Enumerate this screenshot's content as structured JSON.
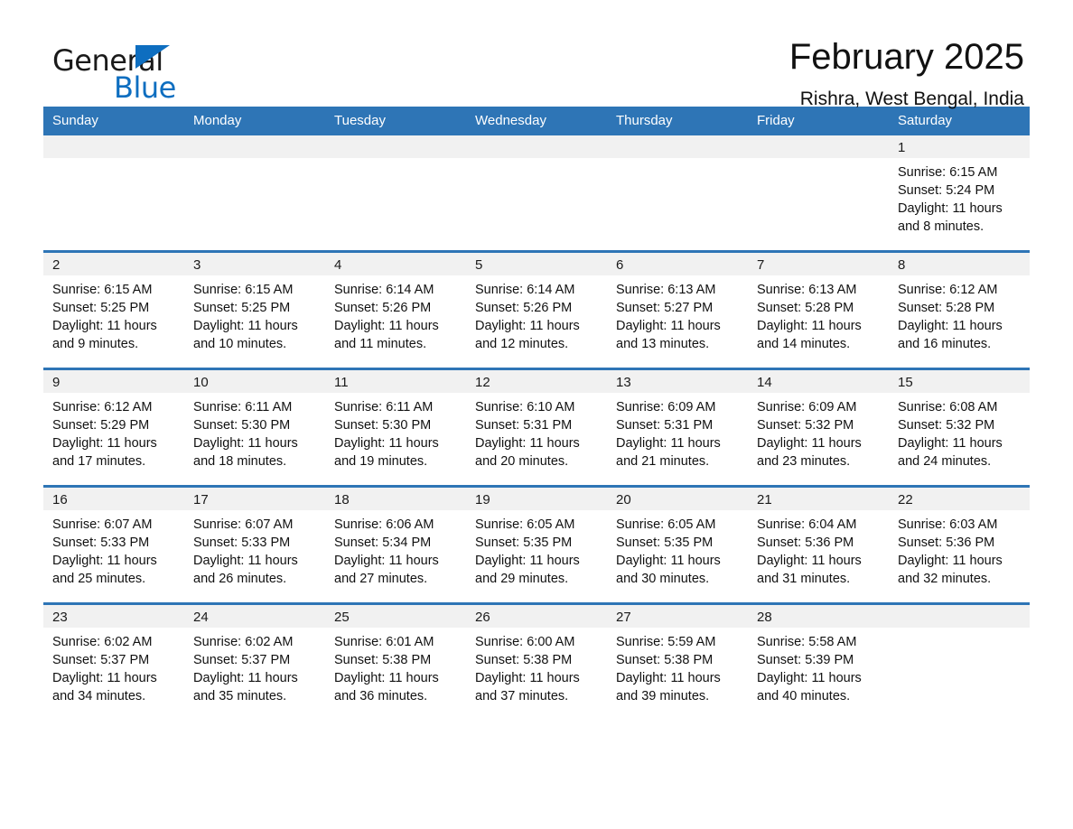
{
  "logo": {
    "word_top": "General",
    "word_bottom": "Blue",
    "triangle_icon": "triangle-icon",
    "brand_color": "#0e6ec0"
  },
  "header": {
    "month_title": "February 2025",
    "location": "Rishra, West Bengal, India"
  },
  "theme": {
    "header_blue": "#2e75b6",
    "daynum_band": "#f1f1f1",
    "text": "#111111"
  },
  "calendar": {
    "weekday_headers": [
      "Sunday",
      "Monday",
      "Tuesday",
      "Wednesday",
      "Thursday",
      "Friday",
      "Saturday"
    ],
    "weeks": [
      [
        {
          "day": ""
        },
        {
          "day": ""
        },
        {
          "day": ""
        },
        {
          "day": ""
        },
        {
          "day": ""
        },
        {
          "day": ""
        },
        {
          "day": "1",
          "sunrise": "Sunrise: 6:15 AM",
          "sunset": "Sunset: 5:24 PM",
          "daylight": "Daylight: 11 hours and 8 minutes."
        }
      ],
      [
        {
          "day": "2",
          "sunrise": "Sunrise: 6:15 AM",
          "sunset": "Sunset: 5:25 PM",
          "daylight": "Daylight: 11 hours and 9 minutes."
        },
        {
          "day": "3",
          "sunrise": "Sunrise: 6:15 AM",
          "sunset": "Sunset: 5:25 PM",
          "daylight": "Daylight: 11 hours and 10 minutes."
        },
        {
          "day": "4",
          "sunrise": "Sunrise: 6:14 AM",
          "sunset": "Sunset: 5:26 PM",
          "daylight": "Daylight: 11 hours and 11 minutes."
        },
        {
          "day": "5",
          "sunrise": "Sunrise: 6:14 AM",
          "sunset": "Sunset: 5:26 PM",
          "daylight": "Daylight: 11 hours and 12 minutes."
        },
        {
          "day": "6",
          "sunrise": "Sunrise: 6:13 AM",
          "sunset": "Sunset: 5:27 PM",
          "daylight": "Daylight: 11 hours and 13 minutes."
        },
        {
          "day": "7",
          "sunrise": "Sunrise: 6:13 AM",
          "sunset": "Sunset: 5:28 PM",
          "daylight": "Daylight: 11 hours and 14 minutes."
        },
        {
          "day": "8",
          "sunrise": "Sunrise: 6:12 AM",
          "sunset": "Sunset: 5:28 PM",
          "daylight": "Daylight: 11 hours and 16 minutes."
        }
      ],
      [
        {
          "day": "9",
          "sunrise": "Sunrise: 6:12 AM",
          "sunset": "Sunset: 5:29 PM",
          "daylight": "Daylight: 11 hours and 17 minutes."
        },
        {
          "day": "10",
          "sunrise": "Sunrise: 6:11 AM",
          "sunset": "Sunset: 5:30 PM",
          "daylight": "Daylight: 11 hours and 18 minutes."
        },
        {
          "day": "11",
          "sunrise": "Sunrise: 6:11 AM",
          "sunset": "Sunset: 5:30 PM",
          "daylight": "Daylight: 11 hours and 19 minutes."
        },
        {
          "day": "12",
          "sunrise": "Sunrise: 6:10 AM",
          "sunset": "Sunset: 5:31 PM",
          "daylight": "Daylight: 11 hours and 20 minutes."
        },
        {
          "day": "13",
          "sunrise": "Sunrise: 6:09 AM",
          "sunset": "Sunset: 5:31 PM",
          "daylight": "Daylight: 11 hours and 21 minutes."
        },
        {
          "day": "14",
          "sunrise": "Sunrise: 6:09 AM",
          "sunset": "Sunset: 5:32 PM",
          "daylight": "Daylight: 11 hours and 23 minutes."
        },
        {
          "day": "15",
          "sunrise": "Sunrise: 6:08 AM",
          "sunset": "Sunset: 5:32 PM",
          "daylight": "Daylight: 11 hours and 24 minutes."
        }
      ],
      [
        {
          "day": "16",
          "sunrise": "Sunrise: 6:07 AM",
          "sunset": "Sunset: 5:33 PM",
          "daylight": "Daylight: 11 hours and 25 minutes."
        },
        {
          "day": "17",
          "sunrise": "Sunrise: 6:07 AM",
          "sunset": "Sunset: 5:33 PM",
          "daylight": "Daylight: 11 hours and 26 minutes."
        },
        {
          "day": "18",
          "sunrise": "Sunrise: 6:06 AM",
          "sunset": "Sunset: 5:34 PM",
          "daylight": "Daylight: 11 hours and 27 minutes."
        },
        {
          "day": "19",
          "sunrise": "Sunrise: 6:05 AM",
          "sunset": "Sunset: 5:35 PM",
          "daylight": "Daylight: 11 hours and 29 minutes."
        },
        {
          "day": "20",
          "sunrise": "Sunrise: 6:05 AM",
          "sunset": "Sunset: 5:35 PM",
          "daylight": "Daylight: 11 hours and 30 minutes."
        },
        {
          "day": "21",
          "sunrise": "Sunrise: 6:04 AM",
          "sunset": "Sunset: 5:36 PM",
          "daylight": "Daylight: 11 hours and 31 minutes."
        },
        {
          "day": "22",
          "sunrise": "Sunrise: 6:03 AM",
          "sunset": "Sunset: 5:36 PM",
          "daylight": "Daylight: 11 hours and 32 minutes."
        }
      ],
      [
        {
          "day": "23",
          "sunrise": "Sunrise: 6:02 AM",
          "sunset": "Sunset: 5:37 PM",
          "daylight": "Daylight: 11 hours and 34 minutes."
        },
        {
          "day": "24",
          "sunrise": "Sunrise: 6:02 AM",
          "sunset": "Sunset: 5:37 PM",
          "daylight": "Daylight: 11 hours and 35 minutes."
        },
        {
          "day": "25",
          "sunrise": "Sunrise: 6:01 AM",
          "sunset": "Sunset: 5:38 PM",
          "daylight": "Daylight: 11 hours and 36 minutes."
        },
        {
          "day": "26",
          "sunrise": "Sunrise: 6:00 AM",
          "sunset": "Sunset: 5:38 PM",
          "daylight": "Daylight: 11 hours and 37 minutes."
        },
        {
          "day": "27",
          "sunrise": "Sunrise: 5:59 AM",
          "sunset": "Sunset: 5:38 PM",
          "daylight": "Daylight: 11 hours and 39 minutes."
        },
        {
          "day": "28",
          "sunrise": "Sunrise: 5:58 AM",
          "sunset": "Sunset: 5:39 PM",
          "daylight": "Daylight: 11 hours and 40 minutes."
        },
        {
          "day": ""
        }
      ]
    ]
  }
}
